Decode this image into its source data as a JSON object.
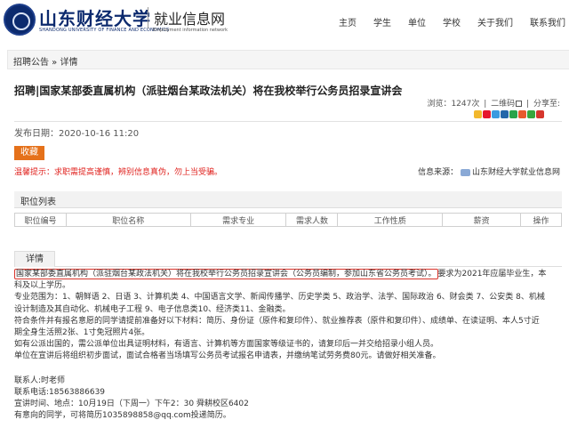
{
  "header": {
    "logo_cn": "山东财经大学",
    "logo_en": "SHANDONG UNIVERSITY OF FINANCE AND ECONOMICS",
    "site_cn": "就业信息网",
    "site_en": "Employment information network",
    "nav": [
      "主页",
      "学生",
      "单位",
      "学校",
      "关于我们",
      "联系我们"
    ]
  },
  "breadcrumb": "招聘公告 » 详情",
  "article": {
    "title": "招聘|国家某部委直属机构（派驻烟台某政法机关）将在我校举行公务员招录宣讲会",
    "views": "浏览：1247次",
    "qrcode": "二维码",
    "share": "分享至:",
    "pubdate": "发布日期：2020-10-16 11:20",
    "fav_label": "收藏",
    "warning": "温馨提示：求职需提高谨慎，辨别信息真伪，勿上当受骗。",
    "source_label": "信息来源：",
    "source_value": "山东财经大学就业信息网"
  },
  "positions": {
    "section_label": "职位列表",
    "columns": [
      "职位编号",
      "职位名称",
      "需求专业",
      "需求人数",
      "工作性质",
      "薪资",
      "操作"
    ]
  },
  "detail_tab": "详情",
  "body": {
    "highlight": "国家某部委直属机构（派驻烟台某政法机关）将在我校举行公务员招录宣讲会（公务员编制，参加山东省公务员考试）。",
    "line1_rest": "要求为2021年应届毕业生，本",
    "line2": "科及以上学历。",
    "line3": "专业范围为：1、朝鲜语 2、日语 3、计算机类 4、中国语言文学、新闻传播学、历史学类 5、政治学、法学、国际政治 6、财会类 7、公安类 8、机械",
    "line4": "设计制造及其自动化、机械电子工程 9、电子信息类10、经济类11、金融类。",
    "line5": "符合条件并有报名意愿的同学请提前准备好以下材料：简历、身份证（原件和复印件）、就业推荐表（原件和复印件）、成绩单、在读证明、本人5寸近",
    "line6": "期全身生活照2张、1寸免冠照片4张。",
    "line7": "如有公派出国的，需公派单位出具证明材料，有语言、计算机等方面国家等级证书的，请复印后一并交给招录小组人员。",
    "line8": "单位在宣讲后将组织初步面试，面试合格者当场填写公务员考试报名申请表，并缴纳笔试劳务费80元。请做好相关准备。",
    "contact": "联系人:时老师",
    "phone": "联系电话:18563886639",
    "time_place": "宣讲时间、地点：10月19日（下周一）下午2：30  舜耕校区6402",
    "email": "有意向的同学，可将简历1035898858@qq.com投递简历。"
  },
  "colors": {
    "brand_blue": "#0c2a6e",
    "fav_orange": "#e5711a",
    "warning_red": "#e0231f",
    "highlight_red": "#d9342b"
  }
}
